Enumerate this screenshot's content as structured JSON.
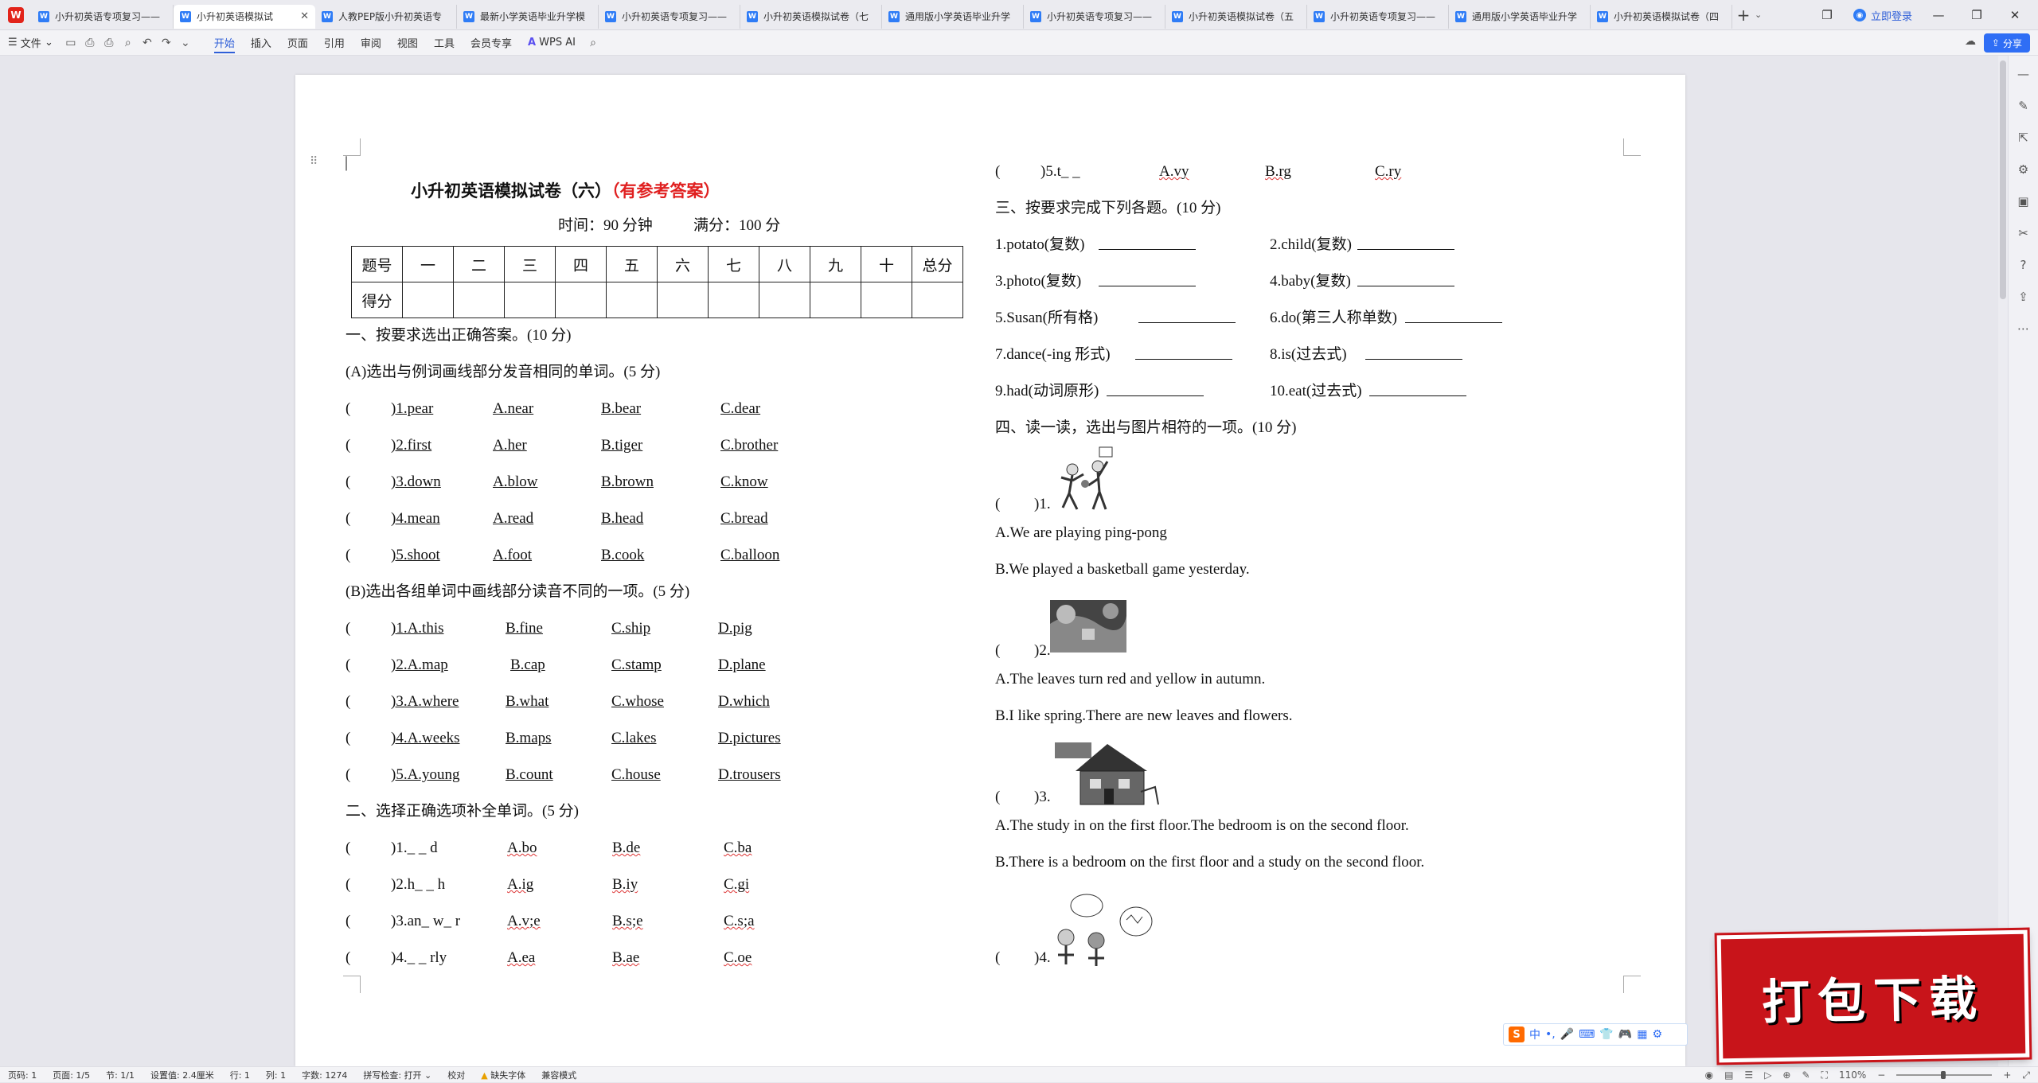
{
  "tabs": [
    {
      "label": "小升初英语专项复习——",
      "active": false
    },
    {
      "label": "小升初英语模拟试",
      "active": true
    },
    {
      "label": "人教PEP版小升初英语专",
      "active": false
    },
    {
      "label": "最新小学英语毕业升学模",
      "active": false
    },
    {
      "label": "小升初英语专项复习——",
      "active": false
    },
    {
      "label": "小升初英语模拟试卷（七",
      "active": false
    },
    {
      "label": "通用版小学英语毕业升学",
      "active": false
    },
    {
      "label": "小升初英语专项复习——",
      "active": false
    },
    {
      "label": "小升初英语模拟试卷（五",
      "active": false
    },
    {
      "label": "小升初英语专项复习——",
      "active": false
    },
    {
      "label": "通用版小学英语毕业升学",
      "active": false
    },
    {
      "label": "小升初英语模拟试卷（四",
      "active": false
    }
  ],
  "login_label": "立即登录",
  "menu": {
    "file": "文件",
    "items": [
      "开始",
      "插入",
      "页面",
      "引用",
      "审阅",
      "视图",
      "工具",
      "会员专享"
    ],
    "wps_ai": "WPS AI",
    "share": "分享"
  },
  "doc": {
    "title_main": "小升初英语模拟试卷（六）",
    "title_note": "（有参考答案）",
    "time": "时间：90 分钟",
    "full": "满分：100 分",
    "score_header": [
      "题号",
      "一",
      "二",
      "三",
      "四",
      "五",
      "六",
      "七",
      "八",
      "九",
      "十",
      "总分"
    ],
    "score_row_label": "得分",
    "s1": "一、按要求选出正确答案。(10 分)",
    "s1a": "(A)选出与例词画线部分发音相同的单词。(5 分)",
    "s1a_items": [
      {
        "q": ")1.pear",
        "a": "A.near",
        "b": "B.bear",
        "c": "C.dear"
      },
      {
        "q": ")2.first",
        "a": "A.her",
        "b": "B.tiger",
        "c": "C.brother"
      },
      {
        "q": ")3.down",
        "a": "A.blow",
        "b": "B.brown",
        "c": "C.know"
      },
      {
        "q": ")4.mean",
        "a": "A.read",
        "b": "B.head",
        "c": "C.bread"
      },
      {
        "q": ")5.shoot",
        "a": "A.foot",
        "b": "B.cook",
        "c": "C.balloon"
      }
    ],
    "s1b": "(B)选出各组单词中画线部分读音不同的一项。(5 分)",
    "s1b_items": [
      {
        "q": ")1.A.this",
        "b": "B.fine",
        "c": "C.ship",
        "d": "D.pig"
      },
      {
        "q": ")2.A.map",
        "b": "B.cap",
        "c": "C.stamp",
        "d": "D.plane"
      },
      {
        "q": ")3.A.where",
        "b": "B.what",
        "c": "C.whose",
        "d": "D.which"
      },
      {
        "q": ")4.A.weeks",
        "b": "B.maps",
        "c": "C.lakes",
        "d": "D.pictures"
      },
      {
        "q": ")5.A.young",
        "b": "B.count",
        "c": "C.house",
        "d": "D.trousers"
      }
    ],
    "s2": "二、选择正确选项补全单词。(5 分)",
    "s2_items": [
      {
        "q": ")1._ _ d",
        "a": "A.bo",
        "b": "B.de",
        "c": "C.ba"
      },
      {
        "q": ")2.h_ _ h",
        "a": "A.ig",
        "b": "B.iy",
        "c": "C.gi"
      },
      {
        "q": ")3.an_ w_ r",
        "a": "A.v;e",
        "b": "B.s;e",
        "c": "C.s;a"
      },
      {
        "q": ")4._ _ rly",
        "a": "A.ea",
        "b": "B.ae",
        "c": "C.oe"
      },
      {
        "q": ")5.t_ _",
        "a": "A.vy",
        "b": "B.rg",
        "c": "C.ry"
      }
    ],
    "paren": "(",
    "s3": "三、按要求完成下列各题。(10 分)",
    "s3_items": [
      {
        "l": "1.potato(复数)",
        "r": "2.child(复数)"
      },
      {
        "l": "3.photo(复数)",
        "r": "4.baby(复数)"
      },
      {
        "l": "5.Susan(所有格)",
        "r": "6.do(第三人称单数)"
      },
      {
        "l": "7.dance(-ing 形式)",
        "r": "8.is(过去式)"
      },
      {
        "l": "9.had(动词原形)",
        "r": "10.eat(过去式)"
      }
    ],
    "s4": "四、读一读，选出与图片相符的一项。(10 分)",
    "s4_items": [
      {
        "q": ")1.",
        "a": "A.We are playing ping-pong",
        "b": "B.We played a basketball game yesterday."
      },
      {
        "q": ")2.",
        "a": "A.The leaves turn red and yellow in autumn.",
        "b": "B.I like spring.There are new leaves and flowers."
      },
      {
        "q": ")3.",
        "a": "A.The study in on the first floor.The bedroom is on the second floor.",
        "b": "B.There is a bedroom on the first floor and a study on the second floor."
      },
      {
        "q": ")4."
      }
    ]
  },
  "status": {
    "page_no": "页码: 1",
    "pages": "页面: 1/5",
    "section": "节: 1/1",
    "setting": "设置值: 2.4厘米",
    "row": "行: 1",
    "col": "列: 1",
    "words": "字数: 1274",
    "spell": "拼写检查: 打开",
    "proof": "校对",
    "missing_font": "缺失字体",
    "compat": "兼容模式",
    "zoom": "110%"
  },
  "ime": {
    "logo": "S",
    "lang": "中"
  },
  "badge": "打包下载"
}
